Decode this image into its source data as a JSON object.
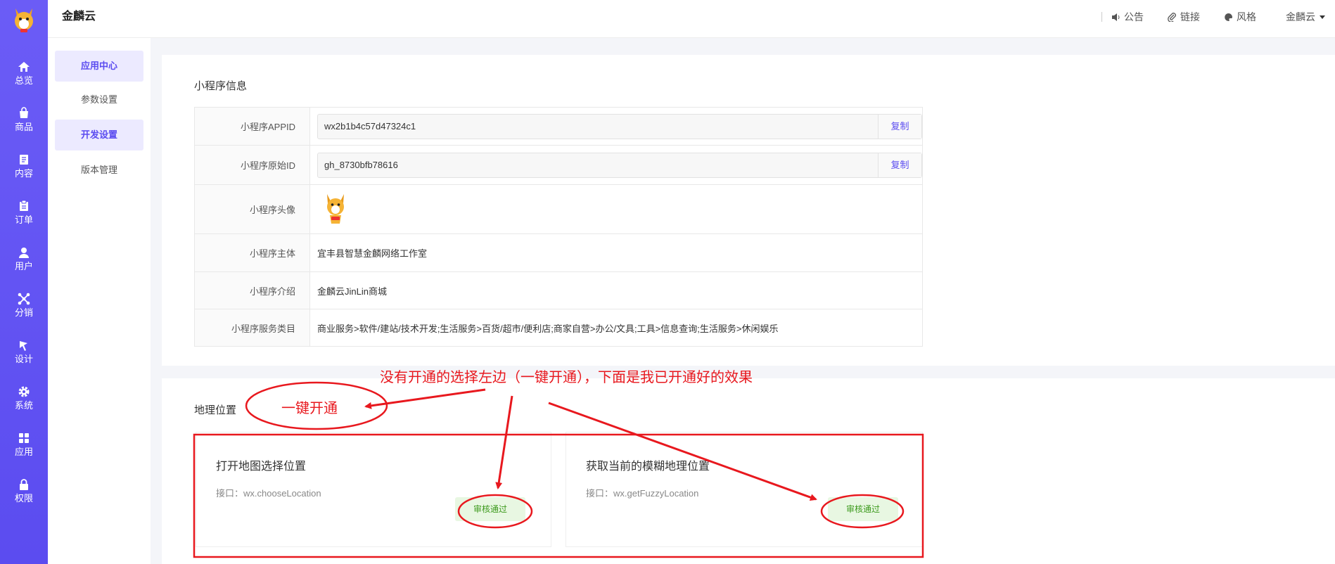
{
  "app": {
    "brand": "金麟云"
  },
  "rail": {
    "items": [
      {
        "label": "总览",
        "icon": "home-icon"
      },
      {
        "label": "商品",
        "icon": "bag-icon"
      },
      {
        "label": "内容",
        "icon": "document-icon"
      },
      {
        "label": "订单",
        "icon": "clipboard-icon"
      },
      {
        "label": "用户",
        "icon": "user-icon"
      },
      {
        "label": "分销",
        "icon": "network-icon"
      },
      {
        "label": "设计",
        "icon": "design-icon"
      },
      {
        "label": "系统",
        "icon": "gear-icon"
      },
      {
        "label": "应用",
        "icon": "grid-icon"
      },
      {
        "label": "权限",
        "icon": "lock-icon"
      }
    ]
  },
  "submenu": {
    "items": [
      {
        "label": "应用中心",
        "active": true
      },
      {
        "label": "参数设置",
        "active": false
      },
      {
        "label": "开发设置",
        "active": true
      },
      {
        "label": "版本管理",
        "active": false
      }
    ]
  },
  "header": {
    "notice": "公告",
    "link": "链接",
    "style": "风格",
    "user": "金麟云"
  },
  "miniprogram": {
    "section_title": "小程序信息",
    "copy_label": "复制",
    "rows": [
      {
        "label": "小程序APPID",
        "value": "wx2b1b4c57d47324c1"
      },
      {
        "label": "小程序原始ID",
        "value": "gh_8730bfb78616"
      },
      {
        "label": "小程序头像",
        "value": ""
      },
      {
        "label": "小程序主体",
        "value": "宜丰县智慧金麟网络工作室"
      },
      {
        "label": "小程序介绍",
        "value": "金麟云JinLin商城"
      },
      {
        "label": "小程序服务类目",
        "value": "商业服务>软件/建站/技术开发;生活服务>百货/超市/便利店;商家自营>办公/文具;工具>信息查询;生活服务>休闲娱乐"
      }
    ]
  },
  "location": {
    "section_title": "地理位置",
    "cards": [
      {
        "title": "打开地图选择位置",
        "api": "接口：wx.chooseLocation",
        "status": "审核通过"
      },
      {
        "title": "获取当前的模糊地理位置",
        "api": "接口：wx.getFuzzyLocation",
        "status": "审核通过"
      }
    ]
  },
  "annotation": {
    "note": "没有开通的选择左边（一键开通），下面是我已开通好的效果",
    "one_click": "一键开通",
    "color": "#e8181e"
  },
  "colors": {
    "primary": "#5b4cf0",
    "success_bg": "#e8f7e2",
    "success_text": "#3c9a1c"
  }
}
